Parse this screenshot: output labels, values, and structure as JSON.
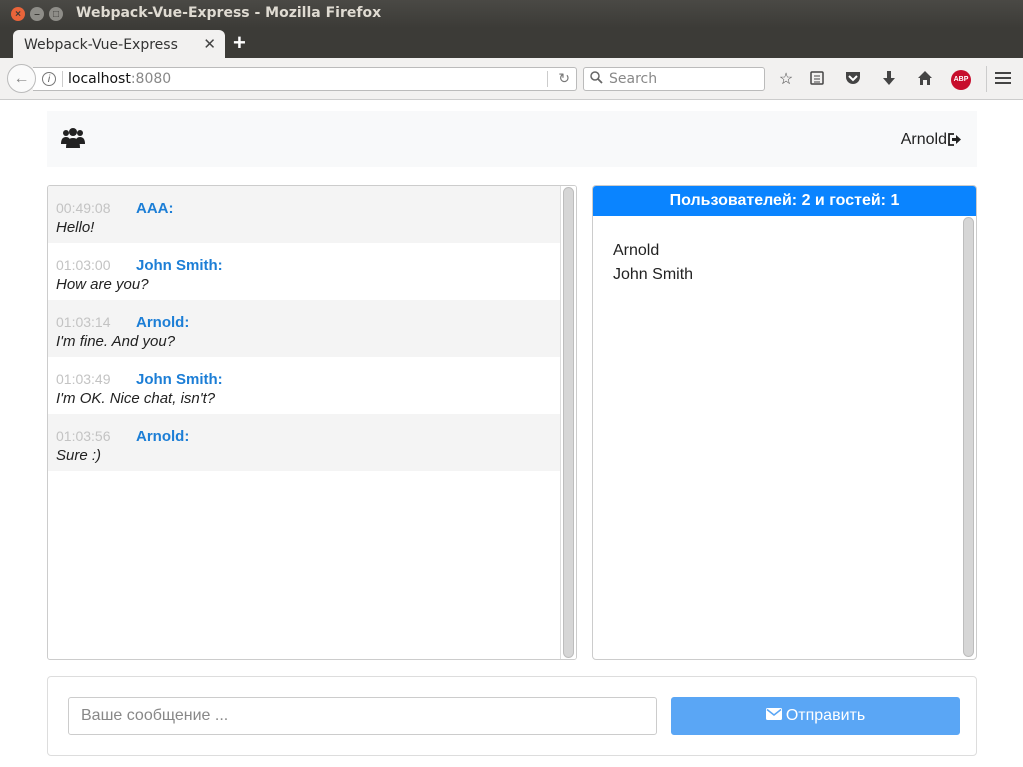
{
  "window": {
    "title": "Webpack-Vue-Express - Mozilla Firefox"
  },
  "tabs": [
    {
      "label": "Webpack-Vue-Express"
    }
  ],
  "navbar": {
    "url_host": "localhost",
    "url_port": ":8080",
    "search_placeholder": "Search",
    "abp_label": "ABP"
  },
  "header": {
    "username": "Arnold"
  },
  "messages": [
    {
      "time": "00:49:08",
      "author": "AAA:",
      "text": "Hello!"
    },
    {
      "time": "01:03:00",
      "author": "John Smith:",
      "text": "How are you?"
    },
    {
      "time": "01:03:14",
      "author": "Arnold:",
      "text": "I'm fine. And you?"
    },
    {
      "time": "01:03:49",
      "author": "John Smith:",
      "text": "I'm OK. Nice chat, isn't?"
    },
    {
      "time": "01:03:56",
      "author": "Arnold:",
      "text": "Sure :)"
    }
  ],
  "users_panel": {
    "header": "Пользователей: 2 и гостей: 1",
    "users": [
      "Arnold",
      "John Smith"
    ]
  },
  "composer": {
    "placeholder": "Ваше сообщение ...",
    "send_label": "Отправить"
  },
  "colors": {
    "accent": "#0a84ff",
    "author": "#1c7ed6",
    "send_button": "#5aa6f5"
  }
}
